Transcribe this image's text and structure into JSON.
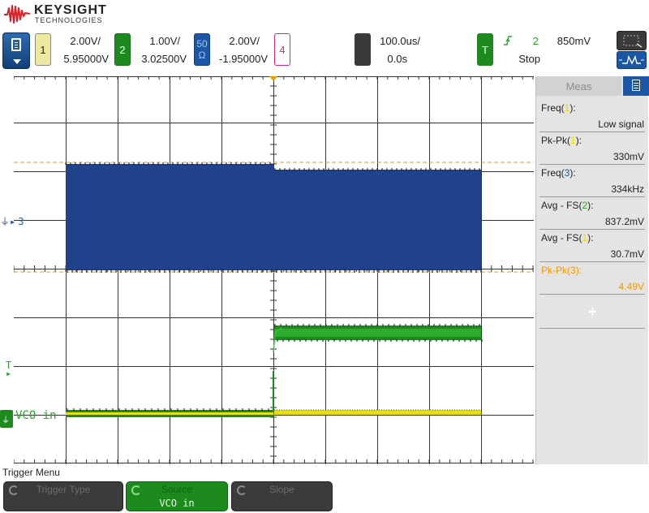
{
  "brand": {
    "name": "KEYSIGHT",
    "sub": "TECHNOLOGIES"
  },
  "channels": [
    {
      "id": "1",
      "scale": "2.00V/",
      "offset": "5.95000V",
      "color": "#e8e000"
    },
    {
      "id": "2",
      "scale": "1.00V/",
      "offset": "3.02500V",
      "color": "#2aa52a"
    },
    {
      "id": "3",
      "scale": "2.00V/",
      "offset": "-1.95000V",
      "color": "#1c57a5",
      "impedance_top": "50",
      "impedance_bottom": "Ω"
    },
    {
      "id": "4",
      "color": "#cc2a8a"
    }
  ],
  "timebase": {
    "scale": "100.0us/",
    "delay": "0.0s"
  },
  "trigger": {
    "badge": "T",
    "source": "2",
    "level": "850mV",
    "state": "Stop"
  },
  "meas": {
    "tab_label": "Meas",
    "items": [
      {
        "label_pre": "Freq(",
        "ch": "1",
        "label_post": "):",
        "value": "Low signal",
        "ch_color": "#e8e000",
        "highlight": false
      },
      {
        "label_pre": "Pk-Pk(",
        "ch": "1",
        "label_post": "):",
        "value": "330mV",
        "ch_color": "#e8e000",
        "highlight": false
      },
      {
        "label_pre": "Freq(",
        "ch": "3",
        "label_post": "):",
        "value": "334kHz",
        "ch_color": "#1c57a5",
        "highlight": false
      },
      {
        "label_pre": "Avg - FS(",
        "ch": "2",
        "label_post": "):",
        "value": "837.2mV",
        "ch_color": "#2aa52a",
        "highlight": false
      },
      {
        "label_pre": "Avg - FS(",
        "ch": "1",
        "label_post": "):",
        "value": "30.7mV",
        "ch_color": "#e8e000",
        "highlight": false
      },
      {
        "label_pre": "Pk-Pk(",
        "ch": "3",
        "label_post": "):",
        "value": "4.49V",
        "ch_color": "#f09a00",
        "highlight": true
      }
    ],
    "add_glyph": "+"
  },
  "markers": {
    "ch3_label": "3",
    "trig_label": "T",
    "ch2_label": "VCO in"
  },
  "menu": {
    "title": "Trigger Menu",
    "softkeys": [
      {
        "label": "Trigger Type",
        "value": "",
        "active": false
      },
      {
        "label": "Source",
        "value": "VCO in",
        "active": true
      },
      {
        "label": "Slope",
        "value": "",
        "active": false
      }
    ]
  },
  "colors": {
    "ch1": "#e8e000",
    "ch2": "#2aa52a",
    "ch3": "#1c57a5",
    "ch3_fill": "#1f3f86",
    "trigger_marker": "#f09a00",
    "grid": "#333333",
    "highlight": "#f09a00"
  },
  "icons": [
    "keysight-wave-logo",
    "menu-document-icon",
    "rotate-knob-icon",
    "add-plus-icon",
    "measure-list-icon"
  ]
}
